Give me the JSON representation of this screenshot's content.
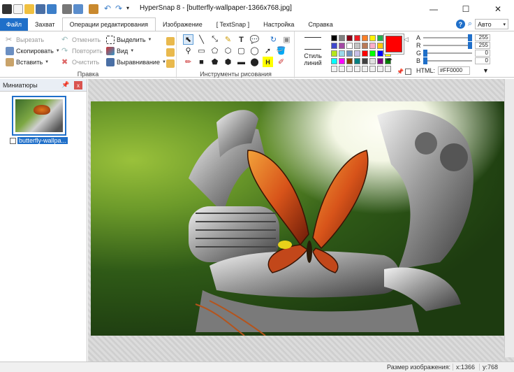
{
  "window": {
    "title": "HyperSnap 8 - [butterfly-wallpaper-1366x768.jpg]",
    "minimize": "—",
    "maximize": "☐",
    "close": "✕"
  },
  "tabs": [
    {
      "label": "Файл"
    },
    {
      "label": "Захват"
    },
    {
      "label": "Операции редактирования"
    },
    {
      "label": "Изображение"
    },
    {
      "label": "[ TextSnap ]"
    },
    {
      "label": "Настройка"
    },
    {
      "label": "Справка"
    }
  ],
  "tabs_right": {
    "help": "?",
    "zoom_mode": "Авто"
  },
  "edit_group": {
    "label": "Правка",
    "cut": "Вырезать",
    "copy": "Скопировать",
    "paste": "Вставить",
    "undo": "Отменить",
    "redo": "Повторить",
    "clear": "Очистить",
    "select": "Выделить",
    "view": "Вид",
    "align": "Выравнивание"
  },
  "drawing_group": {
    "label": "Инструменты рисования"
  },
  "line_style": {
    "label": "Стиль линий"
  },
  "colors": {
    "current": "#ff0000",
    "palette": [
      "#000000",
      "#7f7f7f",
      "#880015",
      "#ed1c24",
      "#ff7f27",
      "#fff200",
      "#22b14c",
      "#00a2e8",
      "#3f48cc",
      "#a349a4",
      "#ffffff",
      "#c3c3c3",
      "#b97a57",
      "#ffaec9",
      "#ffc90e",
      "#efe4b0",
      "#b5e61d",
      "#99d9ea",
      "#7092be",
      "#c8bfe7",
      "#ff0000",
      "#00ff00",
      "#0000ff",
      "#ffff00",
      "#00ffff",
      "#ff00ff",
      "#804000",
      "#008080",
      "#404040",
      "#e0e0e0",
      "#800080",
      "#008000",
      "#f0f0f0",
      "#f0f0f0",
      "#f0f0f0",
      "#f0f0f0",
      "#f0f0f0",
      "#f0f0f0",
      "#f0f0f0",
      "#f0f0f0"
    ],
    "A": "255",
    "R": "255",
    "G": "0",
    "B": "0",
    "html_label": "HTML:",
    "html_value": "#FF0000"
  },
  "thumbnails": {
    "header": "Миниатюры",
    "pin": "📌",
    "close": "x",
    "items": [
      {
        "name": "butterfly-wallpa..."
      }
    ]
  },
  "status": {
    "size": "Размер изображения:",
    "x": "x:1366",
    "y": "y:768"
  }
}
